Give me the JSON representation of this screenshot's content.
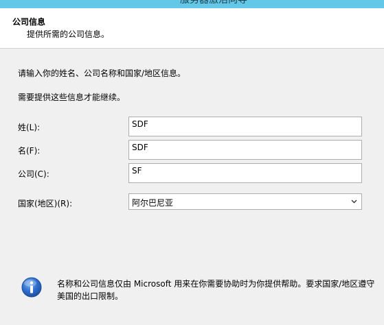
{
  "window": {
    "title": "服务器激活向导"
  },
  "header": {
    "title": "公司信息",
    "subtitle": "提供所需的公司信息。"
  },
  "intro": {
    "line1": "请输入你的姓名、公司名称和国家/地区信息。",
    "line2": "需要提供这些信息才能继续。"
  },
  "form": {
    "last_name": {
      "label": "姓(L):",
      "value": "SDF"
    },
    "first_name": {
      "label": "名(F):",
      "value": "SDF"
    },
    "company": {
      "label": "公司(C):",
      "value": "SF"
    },
    "country": {
      "label": "国家(地区)(R):",
      "value": "阿尔巴尼亚"
    }
  },
  "info": {
    "icon": "info-icon",
    "text": "名称和公司信息仅由 Microsoft 用来在你需要协助时为你提供帮助。要求国家/地区遵守美国的出口限制。"
  }
}
